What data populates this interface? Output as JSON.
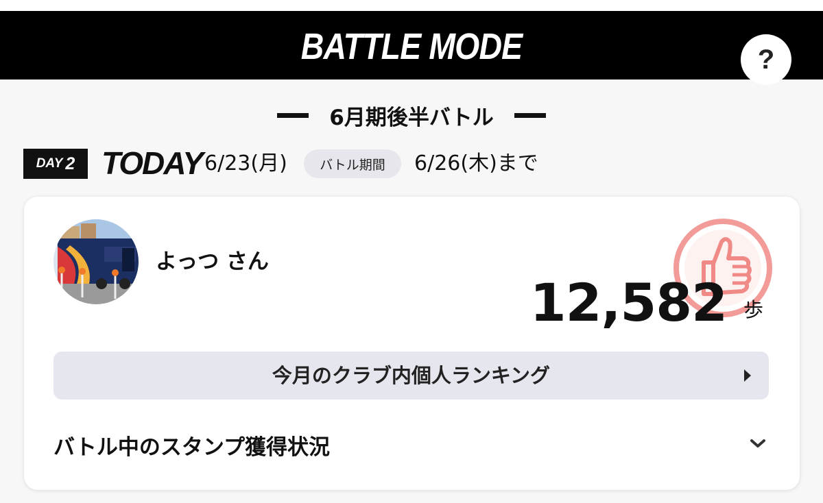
{
  "header": {
    "title": "BATTLE MODE",
    "help_label": "?"
  },
  "battle": {
    "name": "6月期後半バトル",
    "day_word": "DAY",
    "day_number": "2",
    "today_label": "TODAY",
    "today_date": "6/23(月)",
    "period_label": "バトル期間",
    "period_end": "6/26(木)まで"
  },
  "user": {
    "name": "よっつ さん",
    "avatar": "team-bus-photo",
    "steps": "12,582",
    "steps_unit": "歩"
  },
  "ranking": {
    "label": "今月のクラブ内個人ランキング",
    "icon": "triangle-right-icon"
  },
  "stamps": {
    "label": "バトル中のスタンプ獲得状況",
    "icon": "chevron-down-icon"
  },
  "colors": {
    "header_bg": "#000000",
    "thumb_icon": "#f08a87",
    "pill_bg": "#e6e6ec",
    "background": "#f7f7f7"
  }
}
